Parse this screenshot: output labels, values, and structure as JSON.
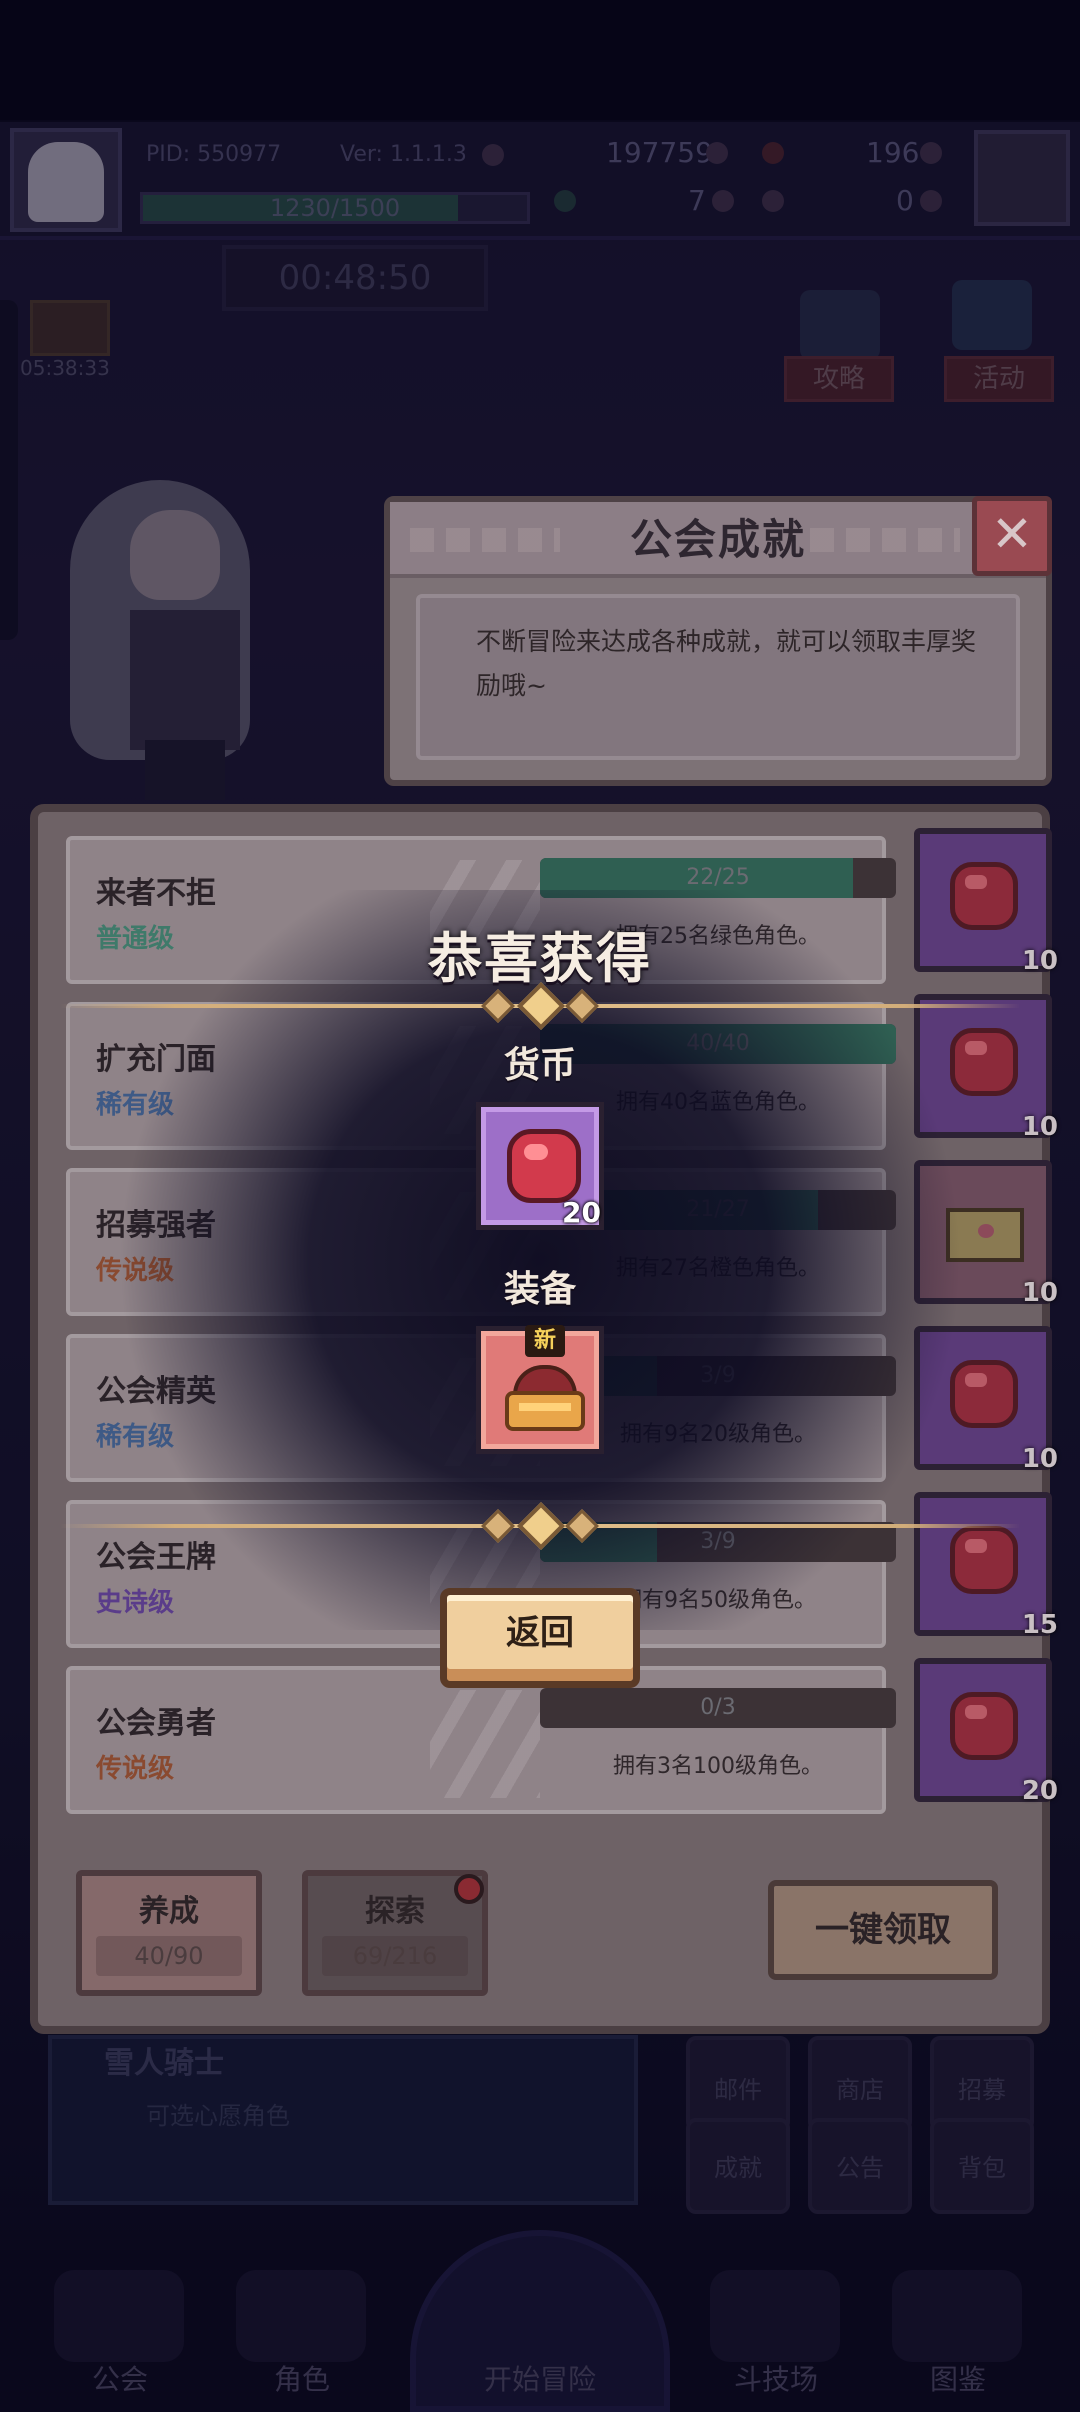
{
  "player": {
    "pid": "PID: 550977",
    "version": "Ver: 1.1.1.3",
    "exp": "1230/1500",
    "exp_fraction": 0.82,
    "coins": "197759",
    "gems": "196",
    "stat_a": "7",
    "stat_b": "0"
  },
  "timers": {
    "main": "00:48:50",
    "gift": "05:38:33"
  },
  "quick_buttons": {
    "guide": "攻略",
    "event": "活动"
  },
  "guild_header": {
    "title": "公会成就",
    "description": "不断冒险来达成各种成就，就可以领取丰厚奖励哦~"
  },
  "achievements": [
    {
      "name": "来者不拒",
      "rank": "普通级",
      "rank_color": "#3f7a6a",
      "progress": "22/25",
      "fraction": 0.88,
      "desc": "拥有25名绿色角色。",
      "reward": "ruby",
      "count": "10"
    },
    {
      "name": "扩充门面",
      "rank": "稀有级",
      "rank_color": "#3e5a86",
      "progress": "40/40",
      "fraction": 1.0,
      "desc": "拥有40名蓝色角色。",
      "reward": "ruby",
      "count": "10"
    },
    {
      "name": "招募强者",
      "rank": "传说级",
      "rank_color": "#8a4a30",
      "progress": "21/27",
      "fraction": 0.78,
      "desc": "拥有27名橙色角色。",
      "reward": "envelope",
      "count": "10"
    },
    {
      "name": "公会精英",
      "rank": "稀有级",
      "rank_color": "#3e5a86",
      "progress": "3/9",
      "fraction": 0.33,
      "desc": "拥有9名20级角色。",
      "reward": "ruby",
      "count": "10"
    },
    {
      "name": "公会王牌",
      "rank": "史诗级",
      "rank_color": "#5a3c8a",
      "progress": "3/9",
      "fraction": 0.33,
      "desc": "拥有9名50级角色。",
      "reward": "ruby",
      "count": "15"
    },
    {
      "name": "公会勇者",
      "rank": "传说级",
      "rank_color": "#8a4a30",
      "progress": "0/3",
      "fraction": 0.0,
      "desc": "拥有3名100级角色。",
      "reward": "ruby",
      "count": "20"
    }
  ],
  "tabs": {
    "train": {
      "label": "养成",
      "value": "40/90"
    },
    "explore": {
      "label": "探索",
      "value": "69/216"
    },
    "claim_all": "一键领取"
  },
  "popup": {
    "title": "恭喜获得",
    "currency_label": "货币",
    "currency_count": "20",
    "equipment_label": "装备",
    "new_tag": "新",
    "back": "返回"
  },
  "banner": {
    "title": "雪人骑士",
    "subtitle": "可选心愿角色"
  },
  "side_menu": [
    "邮件",
    "商店",
    "招募",
    "成就",
    "公告",
    "背包"
  ],
  "nav": [
    "公会",
    "角色",
    "开始冒险",
    "斗技场",
    "图鉴"
  ]
}
